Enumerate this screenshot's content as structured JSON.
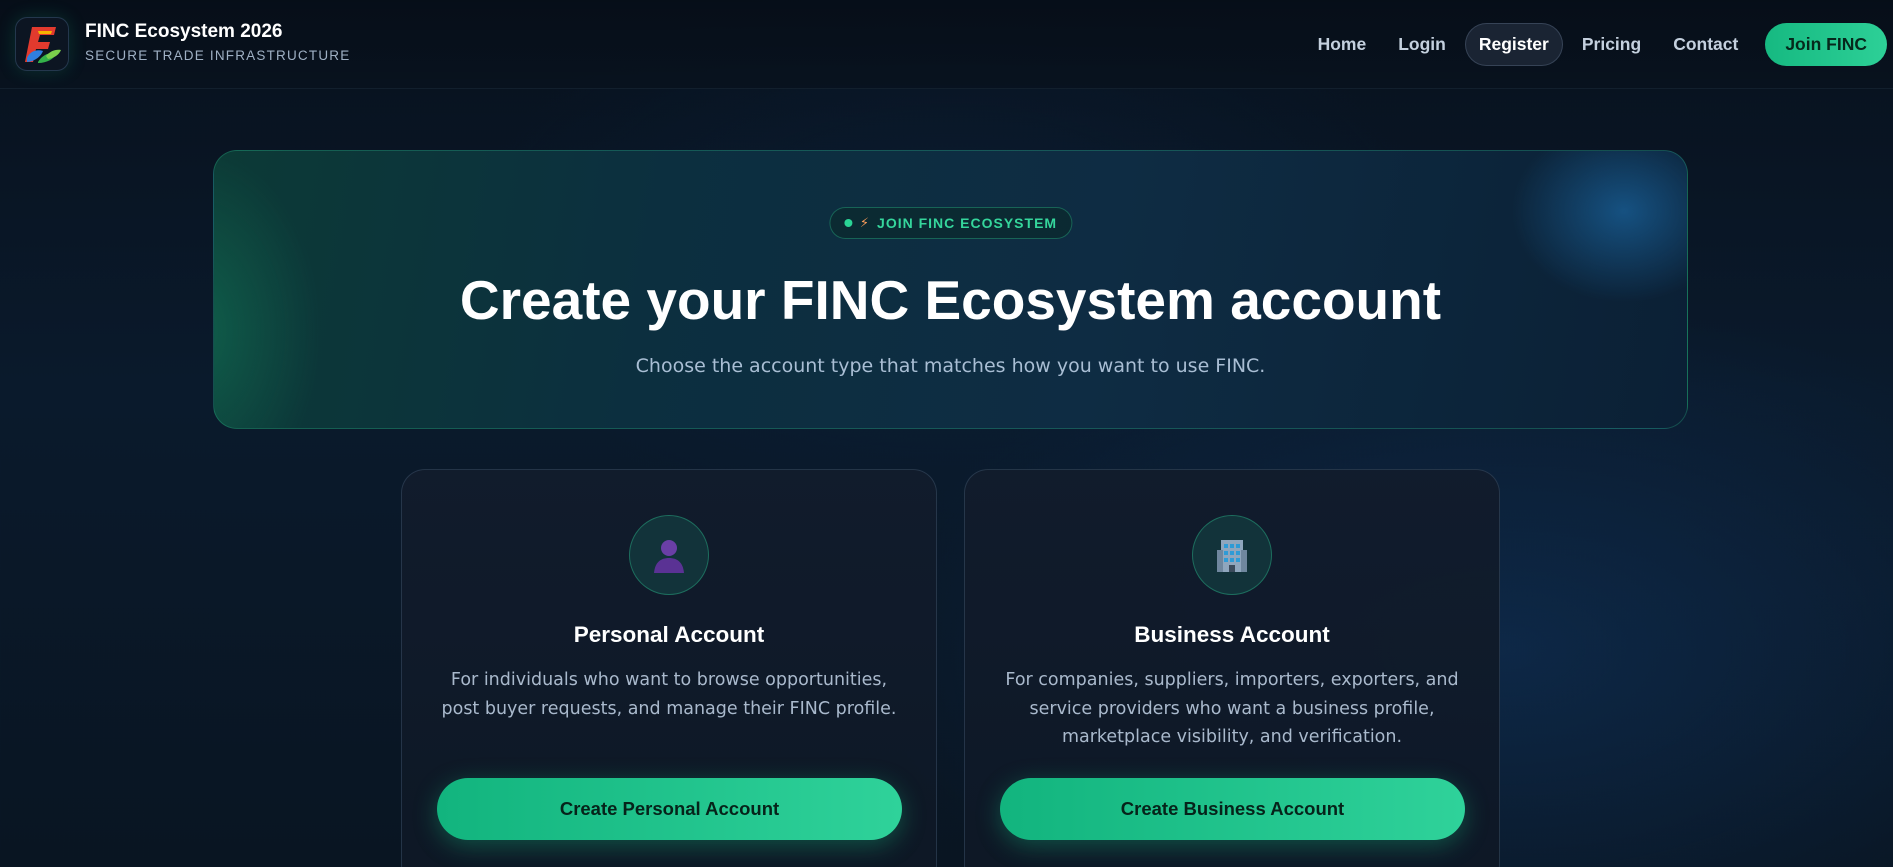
{
  "brand": {
    "title": "FINC Ecosystem 2026",
    "subtitle": "SECURE TRADE INFRASTRUCTURE",
    "logo_icon": "finc-logo-icon"
  },
  "nav": {
    "items": [
      {
        "label": "Home",
        "active": false
      },
      {
        "label": "Login",
        "active": false
      },
      {
        "label": "Register",
        "active": true
      },
      {
        "label": "Pricing",
        "active": false
      },
      {
        "label": "Contact",
        "active": false
      }
    ],
    "cta_label": "Join FINC"
  },
  "hero": {
    "badge": "JOIN FINC ECOSYSTEM",
    "badge_icon": "lightning-bolt-icon",
    "title": "Create your FINC Ecosystem account",
    "subtitle": "Choose the account type that matches how you want to use FINC."
  },
  "cards": [
    {
      "icon": "person-icon",
      "title": "Personal Account",
      "description": "For individuals who want to browse opportunities, post buyer requests, and manage their FINC profile.",
      "button_label": "Create Personal Account"
    },
    {
      "icon": "office-building-icon",
      "title": "Business Account",
      "description": "For companies, suppliers, importers, exporters, and service providers who want a business profile, marketplace visibility, and verification.",
      "button_label": "Create Business Account"
    }
  ],
  "colors": {
    "accent": "#1fc48a",
    "background": "#0a1624",
    "badge_text": "#35d69c"
  }
}
